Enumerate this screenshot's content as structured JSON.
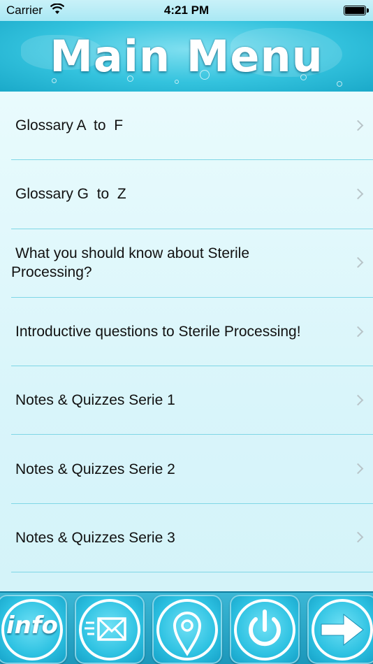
{
  "status_bar": {
    "carrier": "Carrier",
    "time": "4:21 PM"
  },
  "header": {
    "title": "Main Menu"
  },
  "menu": {
    "items": [
      {
        "label": "Glossary A  to  F"
      },
      {
        "label": "Glossary G  to  Z"
      },
      {
        "label": "What you should know about Sterile Processing?"
      },
      {
        "label": "Introductive questions to Sterile Processing!"
      },
      {
        "label": "Notes & Quizzes Serie 1"
      },
      {
        "label": "Notes & Quizzes Serie 2"
      },
      {
        "label": "Notes & Quizzes Serie 3"
      }
    ]
  },
  "toolbar": {
    "info_label": "info",
    "buttons": [
      "info-icon",
      "mail-icon",
      "location-pin-icon",
      "power-icon",
      "arrow-right-icon"
    ]
  },
  "colors": {
    "header": "#34c3de",
    "toolbar": "#1c97ba",
    "separator": "#7fd6e6",
    "list_background": "#d9f5fa"
  }
}
